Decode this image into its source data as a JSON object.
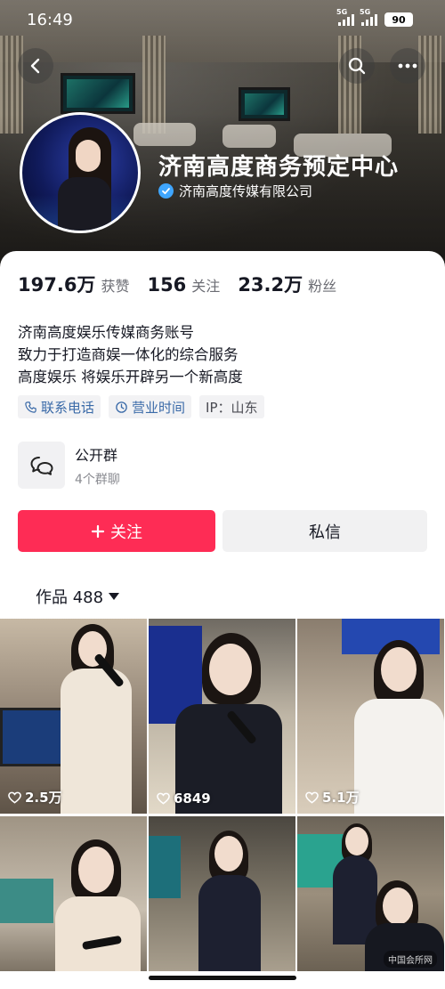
{
  "status_bar": {
    "time": "16:49",
    "network_1": "5G",
    "network_2": "5G",
    "battery": "90"
  },
  "profile": {
    "name": "济南高度商务预定中心",
    "verified_label": "济南高度传媒有限公司",
    "verified_color": "#3fa6ff"
  },
  "stats": {
    "likes_value": "197.6万",
    "likes_label": "获赞",
    "following_value": "156",
    "following_label": "关注",
    "followers_value": "23.2万",
    "followers_label": "粉丝"
  },
  "bio": {
    "lines": [
      "济南高度娱乐传媒商务账号",
      "致力于打造商娱一体化的综合服务",
      "高度娱乐 将娱乐开辟另一个新高度"
    ]
  },
  "tags": {
    "phone": "联系电话",
    "hours": "营业时间",
    "ip": "IP：山东"
  },
  "group": {
    "title": "公开群",
    "subtitle": "4个群聊"
  },
  "actions": {
    "follow": "关注",
    "message": "私信",
    "follow_color": "#fe2c55"
  },
  "works": {
    "label": "作品 488"
  },
  "videos": [
    {
      "likes": "2.5万"
    },
    {
      "likes": "6849"
    },
    {
      "likes": "5.1万"
    },
    {
      "likes": ""
    },
    {
      "likes": ""
    },
    {
      "likes": ""
    }
  ],
  "watermark": "中国会所网"
}
